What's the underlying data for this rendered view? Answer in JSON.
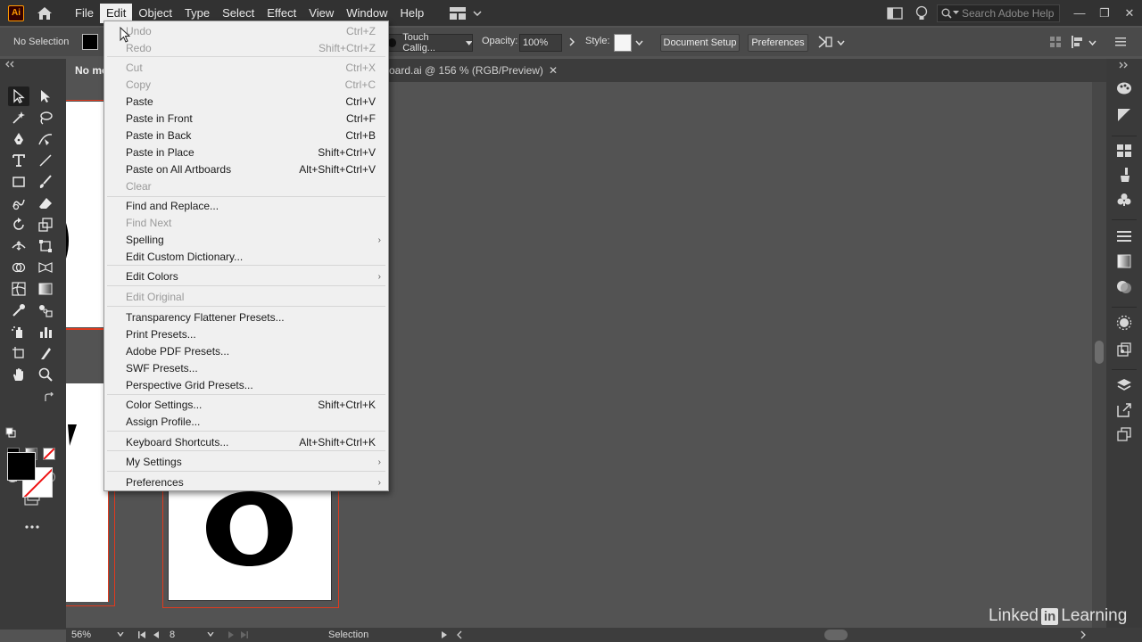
{
  "app": {
    "logo": "Ai"
  },
  "menubar": {
    "items": [
      "File",
      "Edit",
      "Object",
      "Type",
      "Select",
      "Effect",
      "View",
      "Window",
      "Help"
    ],
    "active": "Edit",
    "search_placeholder": "Search Adobe Help"
  },
  "control_bar": {
    "selection_status": "No Selection",
    "brush": "Touch Callig...",
    "opacity_label": "Opacity:",
    "opacity_value": "100%",
    "style_label": "Style:",
    "document_setup": "Document Setup",
    "preferences": "Preferences"
  },
  "tabs": {
    "left_tab": "No mo",
    "document_title": "oard.ai @ 156 % (RGB/Preview)",
    "close": "✕"
  },
  "edit_menu": [
    {
      "label": "Undo",
      "shortcut": "Ctrl+Z",
      "disabled": true
    },
    {
      "label": "Redo",
      "shortcut": "Shift+Ctrl+Z",
      "disabled": true
    },
    {
      "label": "Cut",
      "shortcut": "Ctrl+X",
      "disabled": true
    },
    {
      "label": "Copy",
      "shortcut": "Ctrl+C",
      "disabled": true
    },
    {
      "label": "Paste",
      "shortcut": "Ctrl+V",
      "disabled": false
    },
    {
      "label": "Paste in Front",
      "shortcut": "Ctrl+F",
      "disabled": false
    },
    {
      "label": "Paste in Back",
      "shortcut": "Ctrl+B",
      "disabled": false
    },
    {
      "label": "Paste in Place",
      "shortcut": "Shift+Ctrl+V",
      "disabled": false
    },
    {
      "label": "Paste on All Artboards",
      "shortcut": "Alt+Shift+Ctrl+V",
      "disabled": false
    },
    {
      "label": "Clear",
      "shortcut": "",
      "disabled": true
    },
    {
      "label": "Find and Replace...",
      "shortcut": "",
      "disabled": false
    },
    {
      "label": "Find Next",
      "shortcut": "",
      "disabled": true
    },
    {
      "label": "Spelling",
      "shortcut": "",
      "disabled": false,
      "submenu": true
    },
    {
      "label": "Edit Custom Dictionary...",
      "shortcut": "",
      "disabled": false
    },
    {
      "label": "Edit Colors",
      "shortcut": "",
      "disabled": false,
      "submenu": true
    },
    {
      "label": "Edit Original",
      "shortcut": "",
      "disabled": true
    },
    {
      "label": "Transparency Flattener Presets...",
      "shortcut": "",
      "disabled": false
    },
    {
      "label": "Print Presets...",
      "shortcut": "",
      "disabled": false
    },
    {
      "label": "Adobe PDF Presets...",
      "shortcut": "",
      "disabled": false
    },
    {
      "label": "SWF Presets...",
      "shortcut": "",
      "disabled": false
    },
    {
      "label": "Perspective Grid Presets...",
      "shortcut": "",
      "disabled": false
    },
    {
      "label": "Color Settings...",
      "shortcut": "Shift+Ctrl+K",
      "disabled": false
    },
    {
      "label": "Assign Profile...",
      "shortcut": "",
      "disabled": false
    },
    {
      "label": "Keyboard Shortcuts...",
      "shortcut": "Alt+Shift+Ctrl+K",
      "disabled": false
    },
    {
      "label": "My Settings",
      "shortcut": "",
      "disabled": false,
      "submenu": true
    },
    {
      "label": "Preferences",
      "shortcut": "",
      "disabled": false,
      "submenu": true
    }
  ],
  "status_bar": {
    "zoom": "56%",
    "artboard_number": "8",
    "tool": "Selection"
  },
  "watermark": {
    "left": "Linked",
    "box": "in",
    "right": "Learning"
  },
  "colors": {
    "fill": "#000000",
    "stroke": "none",
    "artboard_border": "#e03a1e",
    "ui_background": "#535353"
  }
}
